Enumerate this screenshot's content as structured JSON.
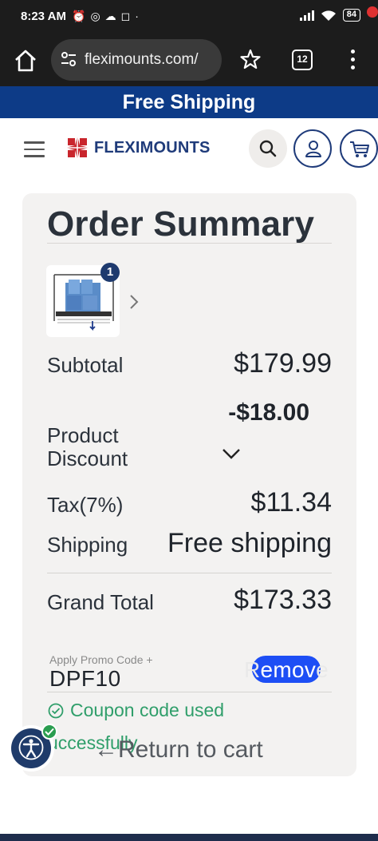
{
  "status_bar": {
    "time": "8:23 AM",
    "notification_icons": [
      "alarm-icon",
      "whatsapp-icon",
      "cloud-icon",
      "instagram-icon",
      "dot-icon"
    ],
    "battery": "84"
  },
  "browser": {
    "url": "fleximounts.com/",
    "tab_count": "12"
  },
  "promo_banner": {
    "text": "Free Shipping",
    "color": "#0d3b87"
  },
  "site_header": {
    "brand": "FLEXIMOUNTS",
    "brand_color": "#1f3b7a",
    "logo_mark_color": "#c9252c"
  },
  "order_summary": {
    "title": "Order Summary",
    "item_quantity": "1",
    "subtotal": {
      "label": "Subtotal",
      "value": "$179.99"
    },
    "discount": {
      "label_line1": "Product",
      "label_line2": "Discount",
      "value": "-$18.00"
    },
    "tax": {
      "label": "Tax(7%)",
      "value": "$11.34"
    },
    "shipping": {
      "label": "Shipping",
      "value": "Free shipping"
    },
    "grand_total": {
      "label": "Grand Total",
      "value": "$173.33"
    },
    "promo": {
      "label": "Apply Promo Code +",
      "code": "DPF10",
      "remove_prefix": "R",
      "remove_main": "emov",
      "remove_suffix": "e"
    },
    "coupon_message_line1": "Coupon code used",
    "coupon_message_line2": "uccessfully",
    "return_link": "Return to cart",
    "success_color": "#2f9e6a"
  }
}
